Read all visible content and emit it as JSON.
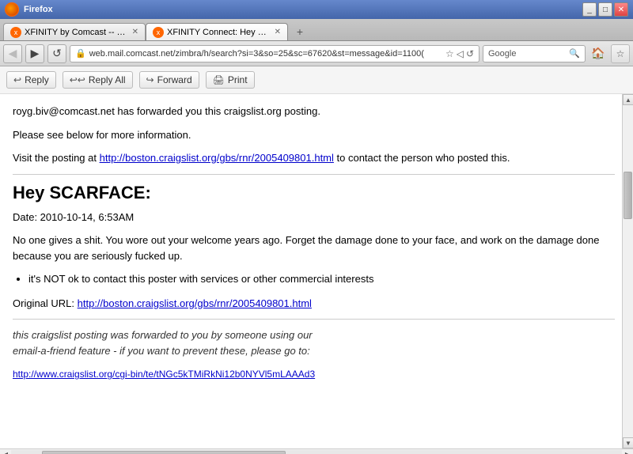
{
  "browser": {
    "ff_title": "Firefox",
    "tabs": [
      {
        "id": "tab1",
        "label": "XFINITY by Comcast -- Official Customer ...",
        "active": false,
        "favicon": "x"
      },
      {
        "id": "tab2",
        "label": "XFINITY Connect: Hey SCARFACE:",
        "active": true,
        "favicon": "x"
      }
    ],
    "add_tab_label": "+",
    "address_bar": "web.mail.comcast.net/zimbra/h/search?si=3&so=25&sc=67620&st=message&id=1100(",
    "search_placeholder": "Google",
    "window_controls": {
      "minimize": "_",
      "maximize": "□",
      "close": "✕"
    },
    "nav": {
      "back": "◀",
      "forward": "▶",
      "refresh": "↺",
      "stop": "✕",
      "home": "🏠"
    }
  },
  "toolbar": {
    "reply_label": "Reply",
    "reply_all_label": "Reply All",
    "forward_label": "Forward",
    "print_label": "Print"
  },
  "email": {
    "forwarded_notice": "royg.biv@comcast.net has forwarded you this craigslist.org posting.",
    "see_below": "Please see below for more information.",
    "visit_text_before": "Visit the posting at ",
    "visit_link": "http://boston.craigslist.org/gbs/rnr/2005409801.html",
    "visit_text_after": " to contact the person who posted this.",
    "heading": "Hey SCARFACE:",
    "date_label": "Date: 2010-10-14, 6:53AM",
    "body_text": "No one gives a shit. You wore out your welcome years ago. Forget the damage done to your face, and work on the damage done because you are seriously fucked up.",
    "bullet_item": "it's NOT ok to contact this poster with services or other commercial interests",
    "original_url_label": "Original URL: ",
    "original_url": "http://boston.craigslist.org/gbs/rnr/2005409801.html",
    "footer_line1": "this craigslist posting was forwarded to you by someone using our",
    "footer_line2": "email-a-friend feature - if you want to prevent these, please go to:",
    "footer_url": "http://www.craigslist.org/cgi-bin/te/tNGc5kTMiRkNi12b0NYVl5mLAAAd3"
  }
}
